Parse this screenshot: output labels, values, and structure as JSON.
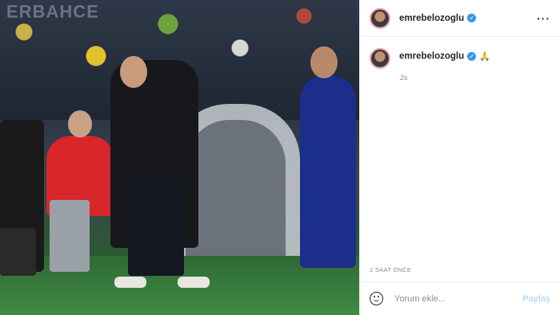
{
  "photo": {
    "stadium_banner": "ERBAHCE"
  },
  "header": {
    "username": "emrebelozoglu",
    "verified_icon": "verified-badge-icon",
    "more_icon": "more-options-icon"
  },
  "caption": {
    "username": "emrebelozoglu",
    "emoji": "🙏",
    "time_ago": "2s"
  },
  "post_date": "2 SAAT ÖNCE",
  "comment_box": {
    "emoji_icon": "smile-icon",
    "placeholder": "Yorum ekle...",
    "post_label": "Paylaş"
  },
  "colors": {
    "verified": "#3897f0",
    "post_button_disabled": "#b3dbff",
    "text_primary": "#262626",
    "text_secondary": "#8e8e8e"
  }
}
